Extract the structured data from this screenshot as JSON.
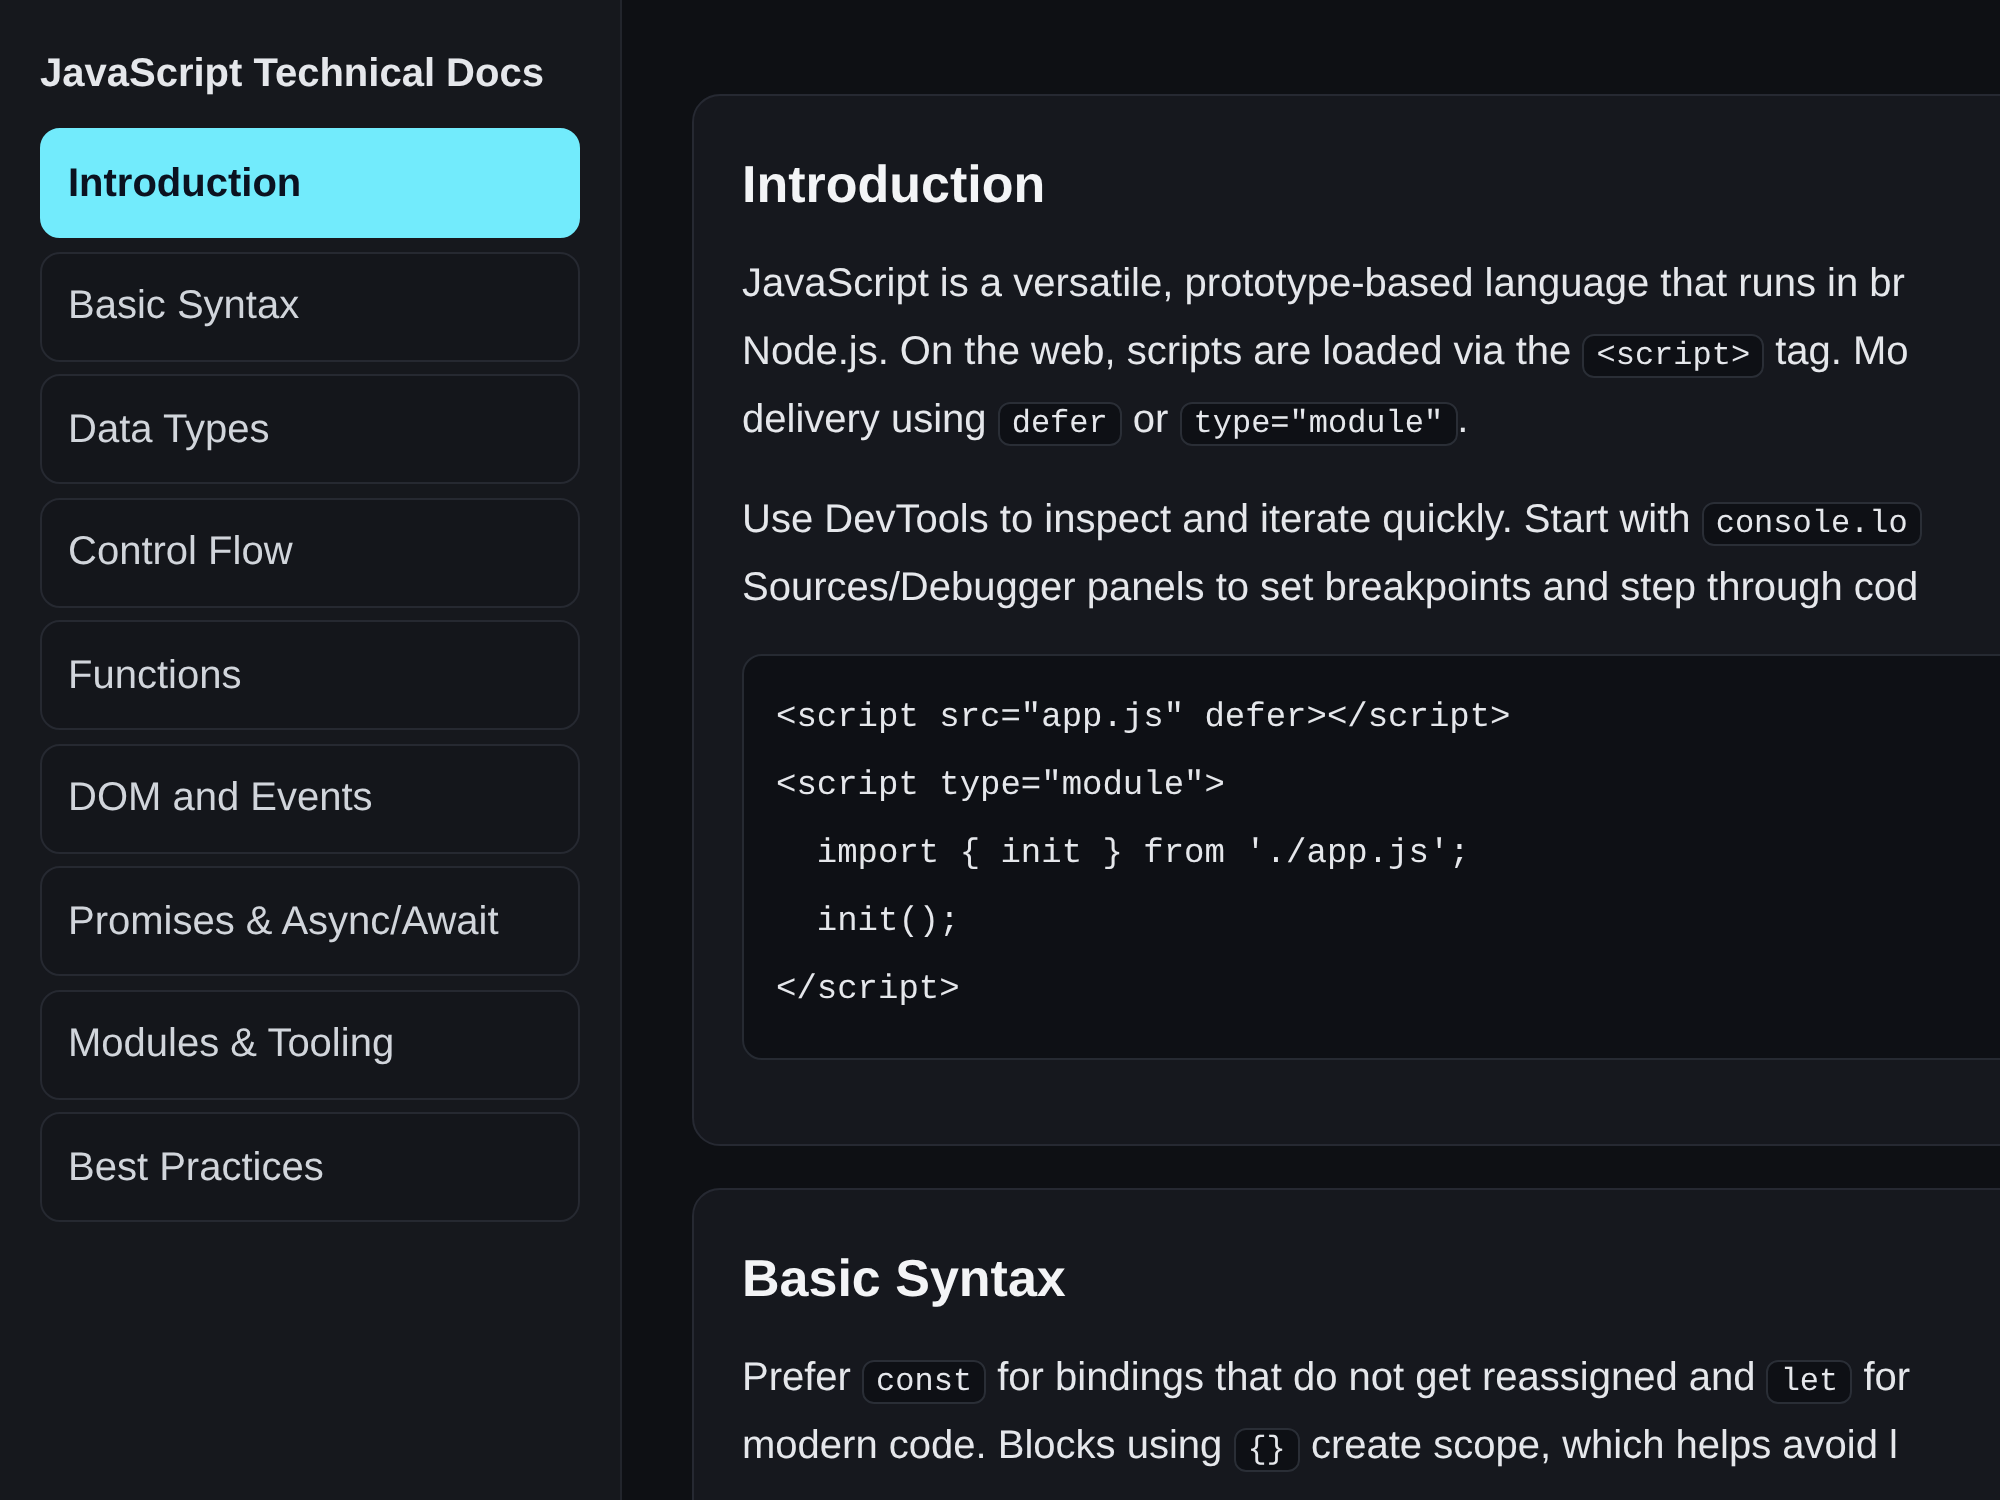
{
  "sidebar": {
    "title": "JavaScript Technical Docs",
    "items": [
      {
        "label": "Introduction",
        "selected": true
      },
      {
        "label": "Basic Syntax",
        "selected": false
      },
      {
        "label": "Data Types",
        "selected": false
      },
      {
        "label": "Control Flow",
        "selected": false
      },
      {
        "label": "Functions",
        "selected": false
      },
      {
        "label": "DOM and Events",
        "selected": false
      },
      {
        "label": "Promises & Async/Await",
        "selected": false
      },
      {
        "label": "Modules & Tooling",
        "selected": false
      },
      {
        "label": "Best Practices",
        "selected": false
      }
    ]
  },
  "sections": [
    {
      "heading": "Introduction",
      "blocks": [
        {
          "kind": "paragraph",
          "lines": [
            [
              {
                "kind": "text",
                "text": "JavaScript is a versatile, prototype-based language that runs in br"
              }
            ],
            [
              {
                "kind": "text",
                "text": "Node.js. On the web, scripts are loaded via the "
              },
              {
                "kind": "code",
                "text": "<script>"
              },
              {
                "kind": "text",
                "text": " tag. Mo"
              }
            ],
            [
              {
                "kind": "text",
                "text": "delivery using "
              },
              {
                "kind": "code",
                "text": "defer"
              },
              {
                "kind": "text",
                "text": " or "
              },
              {
                "kind": "code",
                "text": "type=\"module\""
              },
              {
                "kind": "text",
                "text": "."
              }
            ]
          ]
        },
        {
          "kind": "paragraph",
          "lines": [
            [
              {
                "kind": "text",
                "text": "Use DevTools to inspect and iterate quickly. Start with "
              },
              {
                "kind": "code",
                "text": "console.lo"
              }
            ],
            [
              {
                "kind": "text",
                "text": "Sources/Debugger panels to set breakpoints and step through cod"
              }
            ]
          ]
        },
        {
          "kind": "code",
          "lines": [
            "<script src=\"app.js\" defer></script>",
            "<script type=\"module\">",
            "  import { init } from './app.js';",
            "  init();",
            "</script>"
          ]
        }
      ]
    },
    {
      "heading": "Basic Syntax",
      "blocks": [
        {
          "kind": "paragraph",
          "lines": [
            [
              {
                "kind": "text",
                "text": "Prefer "
              },
              {
                "kind": "code",
                "text": "const"
              },
              {
                "kind": "text",
                "text": " for bindings that do not get reassigned and "
              },
              {
                "kind": "code",
                "text": "let"
              },
              {
                "kind": "text",
                "text": " for"
              }
            ],
            [
              {
                "kind": "text",
                "text": "modern code. Blocks using "
              },
              {
                "kind": "code",
                "text": "{}"
              },
              {
                "kind": "text",
                "text": " create scope, which helps avoid l"
              }
            ]
          ]
        }
      ]
    }
  ]
}
